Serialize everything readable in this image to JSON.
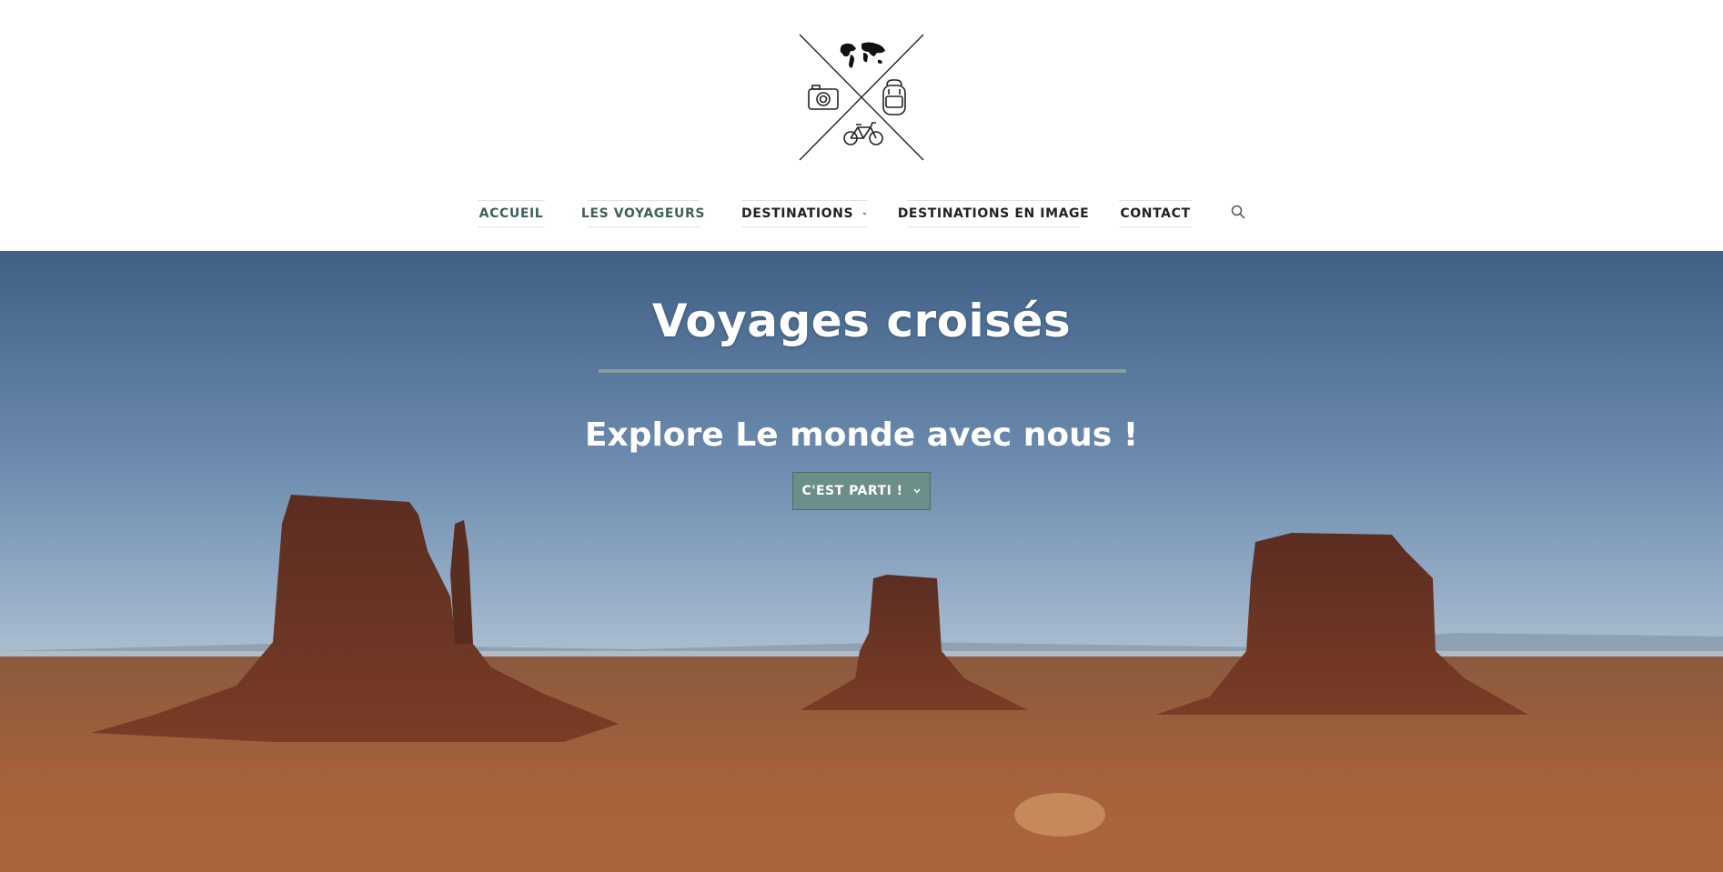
{
  "header": {
    "logo_icons": [
      "world-map-icon",
      "camera-icon",
      "backpack-icon",
      "bicycle-icon"
    ]
  },
  "nav": {
    "items": [
      {
        "label": "ACCUEIL",
        "color": "#3f5f5a"
      },
      {
        "label": "LES VOYAGEURS",
        "color": "#3f5f5a"
      },
      {
        "label": "DESTINATIONS",
        "color": "#222222",
        "has_dropdown": true
      },
      {
        "label": "DESTINATIONS EN IMAGE",
        "color": "#222222"
      },
      {
        "label": "CONTACT",
        "color": "#222222"
      }
    ],
    "search_icon": "search-icon"
  },
  "hero": {
    "title": "Voyages croisés",
    "subtitle": "Explore Le monde avec nous !",
    "cta_label": "C'EST PARTI !",
    "cta_color": "#6c8e88"
  },
  "colors": {
    "accent": "#6c8e88",
    "nav_active": "#3f5f5a"
  }
}
